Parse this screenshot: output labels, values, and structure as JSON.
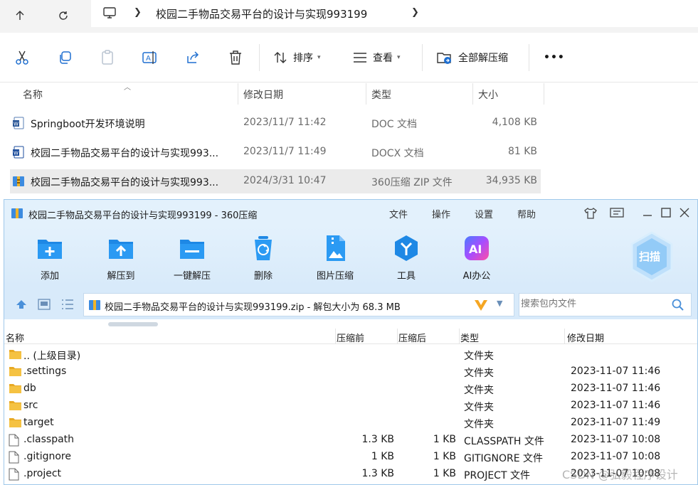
{
  "explorer": {
    "address": {
      "crumb": "校园二手物品交易平台的设计与实现993199"
    },
    "toolbar": {
      "sort_label": "排序",
      "view_label": "查看",
      "extract_all_label": "全部解压缩",
      "more_label": "•••"
    },
    "columns": {
      "name": "名称",
      "modified": "修改日期",
      "type": "类型",
      "size": "大小"
    },
    "files": [
      {
        "name": "Springboot开发环境说明",
        "modified": "2023/11/7 11:42",
        "type": "DOC 文档",
        "size": "4,108 KB",
        "icon": "word-doc-icon"
      },
      {
        "name": "校园二手物品交易平台的设计与实现993...",
        "modified": "2023/11/7 11:49",
        "type": "DOCX 文档",
        "size": "81 KB",
        "icon": "word-docx-icon"
      },
      {
        "name": "校园二手物品交易平台的设计与实现993...",
        "modified": "2024/3/31 10:47",
        "type": "360压缩 ZIP 文件",
        "size": "34,935 KB",
        "icon": "zip-archive-icon"
      }
    ]
  },
  "zip": {
    "title": "校园二手物品交易平台的设计与实现993199 - 360压缩",
    "menu": [
      "文件",
      "操作",
      "设置",
      "帮助"
    ],
    "toolbar": [
      "添加",
      "解压到",
      "一键解压",
      "删除",
      "图片压缩",
      "工具",
      "AI办公"
    ],
    "scan_label": "扫描",
    "path_text": "校园二手物品交易平台的设计与实现993199.zip - 解包大小为 68.3 MB",
    "search_placeholder": "搜索包内文件",
    "columns": {
      "name": "名称",
      "before": "压缩前",
      "after": "压缩后",
      "type": "类型",
      "modified": "修改日期"
    },
    "rows": [
      {
        "name": ".. (上级目录)",
        "before": "",
        "after": "",
        "type": "文件夹",
        "modified": "",
        "kind": "folder"
      },
      {
        "name": ".settings",
        "before": "",
        "after": "",
        "type": "文件夹",
        "modified": "2023-11-07 11:46",
        "kind": "folder"
      },
      {
        "name": "db",
        "before": "",
        "after": "",
        "type": "文件夹",
        "modified": "2023-11-07 11:46",
        "kind": "folder"
      },
      {
        "name": "src",
        "before": "",
        "after": "",
        "type": "文件夹",
        "modified": "2023-11-07 11:46",
        "kind": "folder"
      },
      {
        "name": "target",
        "before": "",
        "after": "",
        "type": "文件夹",
        "modified": "2023-11-07 11:49",
        "kind": "folder"
      },
      {
        "name": ".classpath",
        "before": "1.3 KB",
        "after": "1 KB",
        "type": "CLASSPATH 文件",
        "modified": "2023-11-07 10:08",
        "kind": "file"
      },
      {
        "name": ".gitignore",
        "before": "1 KB",
        "after": "1 KB",
        "type": "GITIGNORE 文件",
        "modified": "2023-11-07 10:08",
        "kind": "file"
      },
      {
        "name": ".project",
        "before": "1.3 KB",
        "after": "1 KB",
        "type": "PROJECT 文件",
        "modified": "2023-11-07 10:08",
        "kind": "file"
      }
    ]
  },
  "watermark": "CSDN @弘毅程序设计",
  "colors": {
    "zip_chrome": "#e3f1fc",
    "zip_blue": "#1e88e5",
    "folder": "#f5c242",
    "selected_row": "#ebebeb"
  }
}
